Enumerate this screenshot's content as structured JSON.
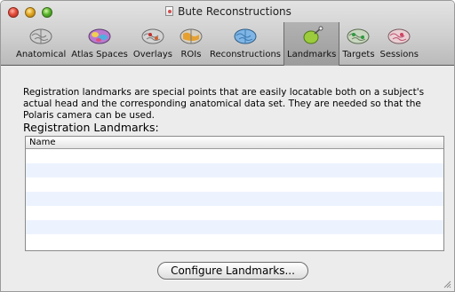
{
  "window": {
    "title": "Bute Reconstructions"
  },
  "toolbar": {
    "tabs": [
      {
        "label": "Anatomical",
        "icon": "brain-gray-icon",
        "active": false
      },
      {
        "label": "Atlas Spaces",
        "icon": "brain-atlas-icon",
        "active": false
      },
      {
        "label": "Overlays",
        "icon": "brain-overlay-icon",
        "active": false
      },
      {
        "label": "ROIs",
        "icon": "brain-roi-icon",
        "active": false
      },
      {
        "label": "Reconstructions",
        "icon": "brain-blue-icon",
        "active": false
      },
      {
        "label": "Landmarks",
        "icon": "landmark-pin-icon",
        "active": true
      },
      {
        "label": "Targets",
        "icon": "brain-target-icon",
        "active": false
      },
      {
        "label": "Sessions",
        "icon": "brain-session-icon",
        "active": false
      }
    ]
  },
  "main": {
    "description": "Registration landmarks are special points that are easily locatable both on a subject's actual head and the corresponding anatomical data set. They are needed so that the Polaris camera can be used.",
    "section_label": "Registration Landmarks:",
    "table": {
      "columns": [
        "Name"
      ],
      "rows": []
    },
    "configure_button": "Configure Landmarks..."
  },
  "colors": {
    "row_alt": "#edf3fe",
    "active_tab": "#a6a6a6"
  }
}
